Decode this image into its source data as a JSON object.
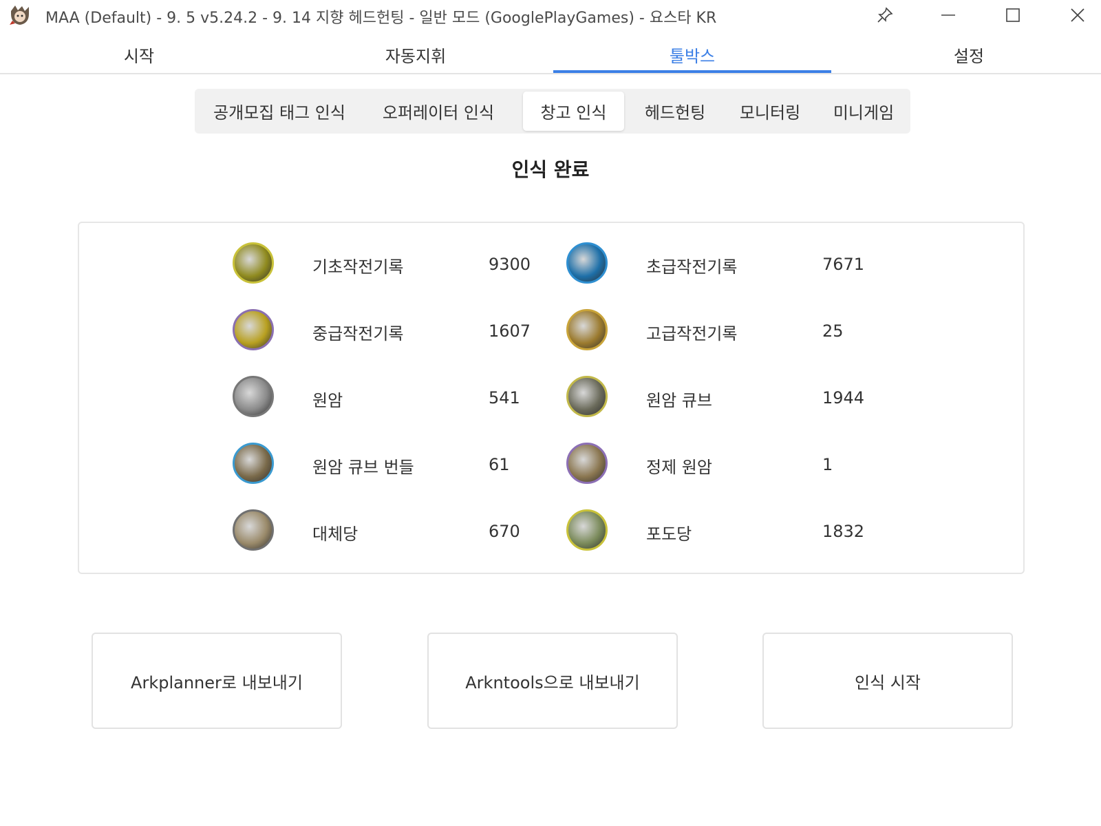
{
  "window": {
    "title": "MAA (Default) -  9. 5 v5.24.2 -  9. 14 지향 헤드헌팅 - 일반 모드 (GooglePlayGames) - 요스타 KR"
  },
  "main_tabs": [
    {
      "label": "시작",
      "active": false
    },
    {
      "label": "자동지휘",
      "active": false
    },
    {
      "label": "툴박스",
      "active": true
    },
    {
      "label": "설정",
      "active": false
    }
  ],
  "sub_tabs": [
    {
      "label": "공개모집 태그 인식",
      "active": false
    },
    {
      "label": "오퍼레이터 인식",
      "active": false
    },
    {
      "label": "창고 인식",
      "active": true
    },
    {
      "label": "헤드헌팅",
      "active": false
    },
    {
      "label": "모니터링",
      "active": false
    },
    {
      "label": "미니게임",
      "active": false
    }
  ],
  "status": "인식 완료",
  "items": [
    {
      "name": "기초작전기록",
      "count": "9300",
      "icon": "basic-battle-record-icon",
      "ring": "#c9c23a",
      "fill": "#8f8a1e"
    },
    {
      "name": "초급작전기록",
      "count": "7671",
      "icon": "drill-battle-record-icon",
      "ring": "#2f8fd1",
      "fill": "#1d6fa8"
    },
    {
      "name": "중급작전기록",
      "count": "1607",
      "icon": "frontline-battle-record-icon",
      "ring": "#8a6fb0",
      "fill": "#b8a020"
    },
    {
      "name": "고급작전기록",
      "count": "25",
      "icon": "tactical-battle-record-icon",
      "ring": "#c9a43a",
      "fill": "#9b7a2e"
    },
    {
      "name": "원암",
      "count": "541",
      "icon": "orirock-icon",
      "ring": "#777777",
      "fill": "#8a8a8a"
    },
    {
      "name": "원암 큐브",
      "count": "1944",
      "icon": "orirock-cube-icon",
      "ring": "#c2b94a",
      "fill": "#6a6a5a"
    },
    {
      "name": "원암 큐브 번들",
      "count": "61",
      "icon": "orirock-cluster-icon",
      "ring": "#3a9ad0",
      "fill": "#7a6a4a"
    },
    {
      "name": "정제 원암",
      "count": "1",
      "icon": "orirock-concentration-icon",
      "ring": "#8c6fb5",
      "fill": "#8a7650"
    },
    {
      "name": "대체당",
      "count": "670",
      "icon": "sugar-substitute-icon",
      "ring": "#707070",
      "fill": "#9a8a6a"
    },
    {
      "name": "포도당",
      "count": "1832",
      "icon": "sugar-icon",
      "ring": "#c9c23a",
      "fill": "#7a8a5a"
    }
  ],
  "actions": {
    "export_arkplanner": "Arkplanner로 내보내기",
    "export_arkntools": "Arkntools으로 내보내기",
    "start_recognition": "인식 시작"
  }
}
